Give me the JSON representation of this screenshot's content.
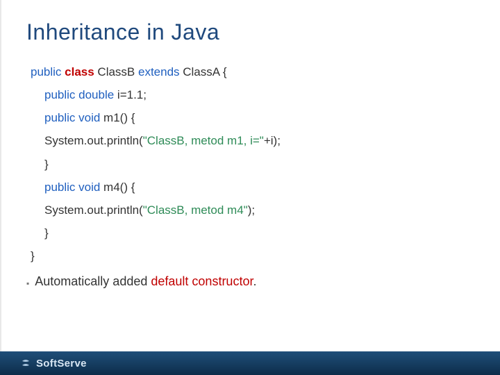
{
  "title": "Inheritance in Java",
  "code": {
    "l1a": "public ",
    "l1b": "class",
    "l1c": " ClassB ",
    "l1d": "extends",
    "l1e": " ClassA {",
    "l2a": "public double",
    "l2b": " i=1.1;",
    "l3a": "public void",
    "l3b": " m1() {",
    "l4a": "System.out.println(",
    "l4b": "\"ClassB, metod m1, i=\"",
    "l4c": "+i);",
    "l5": "}",
    "l6a": "public void",
    "l6b": " m4() {",
    "l7a": "System.out.println(",
    "l7b": "\"ClassB, metod m4\"",
    "l7c": ");",
    "l8": "}",
    "l9": "}"
  },
  "bullet": {
    "a": "Automatically added ",
    "b": "default constructor",
    "c": "."
  },
  "footer": {
    "brand": "SoftServe"
  }
}
